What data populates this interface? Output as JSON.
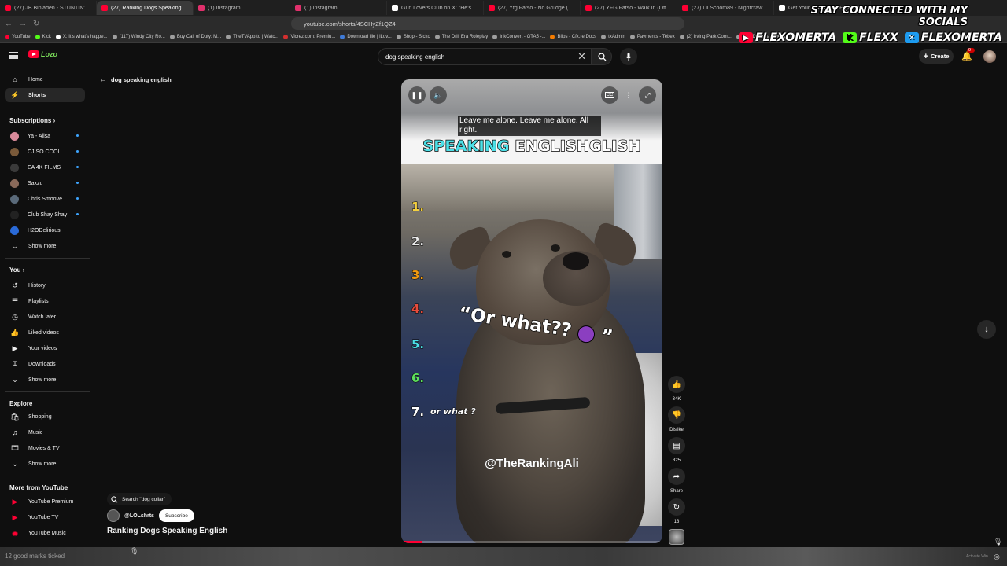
{
  "browser": {
    "tabs": [
      {
        "label": "(27) JB Binladen - STUNTIN' LIKE MY",
        "color": "#ff0033"
      },
      {
        "label": "(27) Ranking Dogs Speaking E...",
        "color": "#ff0033",
        "active": true
      },
      {
        "label": "(1) Instagram",
        "color": "#e1306c"
      },
      {
        "label": "(1) Instagram",
        "color": "#e1306c"
      },
      {
        "label": "Gun Lovers Club on X: \"He's running",
        "color": "#ffffff"
      },
      {
        "label": "(27) Yfg Fatso - No Grudge (unre",
        "color": "#ff0033"
      },
      {
        "label": "(27) YFG Fatso - Walk In (Official Mu",
        "color": "#ff0033"
      },
      {
        "label": "(27) Lil Scoom89 - Nightcrawler (Offi",
        "color": "#ff0033"
      },
      {
        "label": "Get Your Waterfall & Highrise Ice",
        "color": "#ffffff"
      }
    ],
    "url": "youtube.com/shorts/4SCHyZf1QZ4",
    "bookmarks": [
      {
        "label": "YouTube",
        "color": "#ff0033"
      },
      {
        "label": "Kick",
        "color": "#53fc18"
      },
      {
        "label": "X: It's what's happe...",
        "color": "#ffffff"
      },
      {
        "label": "(117) Windy City Ro...",
        "color": "#9e9e9e"
      },
      {
        "label": "Buy Call of Duty: M...",
        "color": "#9e9e9e"
      },
      {
        "label": "TheTVApp.to | Watc...",
        "color": "#9e9e9e"
      },
      {
        "label": "Vicrez.com: Premiu...",
        "color": "#d32f2f"
      },
      {
        "label": "Download file | iLov...",
        "color": "#3f7bd8"
      },
      {
        "label": "Shop - Sicko",
        "color": "#9e9e9e"
      },
      {
        "label": "The Drill Era Roleplay",
        "color": "#9e9e9e"
      },
      {
        "label": "InkConvert - GTA5 -...",
        "color": "#9e9e9e"
      },
      {
        "label": "Blips - Cfx.re Docs",
        "color": "#f57c00"
      },
      {
        "label": "txAdmin",
        "color": "#9e9e9e"
      },
      {
        "label": "Payments - Tebex",
        "color": "#9e9e9e"
      },
      {
        "label": "(2) Irving Park Com...",
        "color": "#9e9e9e"
      },
      {
        "label": "The Drill Era Roleplay",
        "color": "#9e9e9e"
      }
    ]
  },
  "socials": {
    "heading": "STAY CONNECTED WITH MY SOCIALS",
    "items": [
      {
        "label": "FLEXOMERTA",
        "icon": "youtube-icon",
        "color": "#ff0033"
      },
      {
        "label": "FLEXX",
        "icon": "kick-icon",
        "color": "#53fc18"
      },
      {
        "label": "FLEXOMERTA",
        "icon": "x-icon",
        "color": "#1d9bf0"
      }
    ]
  },
  "header": {
    "brand_text": "Lozo",
    "search_value": "dog speaking english",
    "create_label": "Create",
    "notifications_badge": "9+"
  },
  "sidebar": {
    "main": [
      {
        "label": "Home",
        "icon": "home-icon"
      },
      {
        "label": "Shorts",
        "icon": "shorts-icon",
        "active": true
      }
    ],
    "subscriptions_title": "Subscriptions",
    "subscriptions": [
      {
        "label": "Ya - Alisa",
        "color": "#d88a9a",
        "live": true
      },
      {
        "label": "CJ SO COOL",
        "color": "#7a5a3a",
        "live": true
      },
      {
        "label": "EA 4K FILMS",
        "color": "#3a3a3a",
        "live": true
      },
      {
        "label": "Saxzu",
        "color": "#8a6a5a",
        "live": true
      },
      {
        "label": "Chris Smoove",
        "color": "#5a6a7a",
        "live": true
      },
      {
        "label": "Club Shay Shay",
        "color": "#222222",
        "live": true
      },
      {
        "label": "H2ODelirious",
        "color": "#2a6ad8",
        "live": false
      }
    ],
    "show_more_1": "Show more",
    "you_title": "You",
    "you_items": [
      {
        "label": "History",
        "icon": "history-icon"
      },
      {
        "label": "Playlists",
        "icon": "playlists-icon"
      },
      {
        "label": "Watch later",
        "icon": "watch-later-icon"
      },
      {
        "label": "Liked videos",
        "icon": "liked-videos-icon"
      },
      {
        "label": "Your videos",
        "icon": "your-videos-icon"
      },
      {
        "label": "Downloads",
        "icon": "downloads-icon"
      }
    ],
    "show_more_2": "Show more",
    "explore_title": "Explore",
    "explore_items": [
      {
        "label": "Shopping",
        "icon": "shopping-icon"
      },
      {
        "label": "Music",
        "icon": "music-icon"
      },
      {
        "label": "Movies & TV",
        "icon": "movies-icon"
      }
    ],
    "show_more_3": "Show more",
    "more_title": "More from YouTube",
    "more_items": [
      {
        "label": "YouTube Premium",
        "icon": "youtube-premium-icon"
      },
      {
        "label": "YouTube TV",
        "icon": "youtube-tv-icon"
      },
      {
        "label": "YouTube Music",
        "icon": "youtube-music-icon"
      }
    ]
  },
  "main": {
    "back_label": "dog speaking english",
    "search_chip": "Search \"dog collar\"",
    "channel_handle": "@LOLshrts",
    "subscribe_label": "Subscribe",
    "video_title": "Ranking Dogs Speaking English"
  },
  "video": {
    "caption": "Leave me alone. Leave me alone. All right.",
    "title_word1": "SPEAKING",
    "title_word2": "ENGLISHGLISH",
    "ranks": [
      {
        "label": "1.",
        "color": "#f4d03f"
      },
      {
        "label": "2.",
        "color": "#e8e8e8"
      },
      {
        "label": "3.",
        "color": "#f39c12"
      },
      {
        "label": "4.",
        "color": "#e74c3c"
      },
      {
        "label": "5.",
        "color": "#4ce0e8"
      },
      {
        "label": "6.",
        "color": "#5ee05e"
      },
      {
        "label": "7.",
        "color": "#ffffff"
      }
    ],
    "rank7_text": "or what ?",
    "quote": "“Or what?? ",
    "quote_end": " ”",
    "watermark": "@TheRankingAli",
    "progress_fraction": 0.08
  },
  "actions": {
    "likes": "34K",
    "dislike": "Dislike",
    "comments": "325",
    "share": "Share",
    "remix": "13"
  },
  "bottom": {
    "left_text": "12 good marks ticked",
    "right_text": "Activate Win..."
  }
}
